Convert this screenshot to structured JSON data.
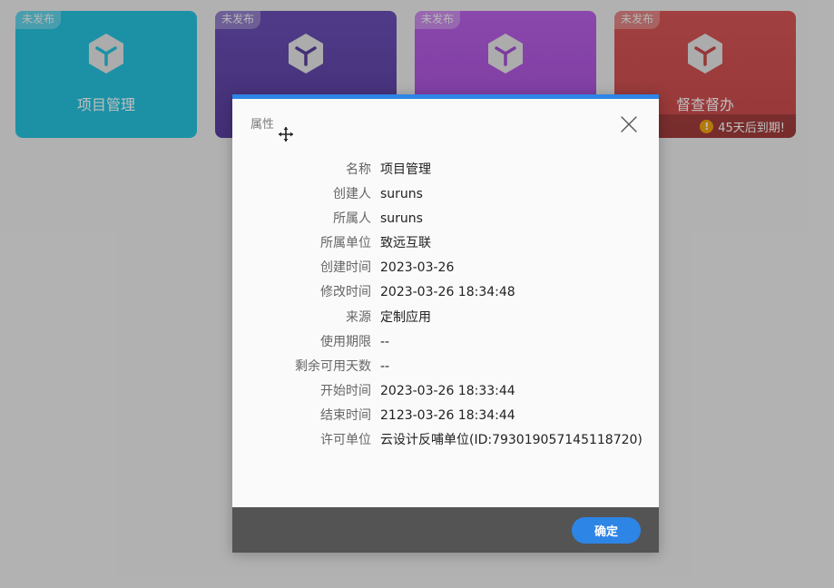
{
  "cards": [
    {
      "badge": "未发布",
      "title": "项目管理",
      "color": "#26c2de",
      "icon_color": "#26c2de"
    },
    {
      "badge": "未发布",
      "title": "",
      "color": "#6a4fb6",
      "icon_color": "#5a3f9e"
    },
    {
      "badge": "未发布",
      "title": "",
      "color": "#b860e6",
      "icon_color": "#a64fd6"
    },
    {
      "badge": "未发布",
      "title": "督查督办",
      "color": "#d75656",
      "icon_color": "#c94a4a",
      "expire_text": "45天后到期!",
      "expire_icon": "warning-icon"
    }
  ],
  "dialog": {
    "title": "属性",
    "confirm_label": "确定",
    "accent": "#2d85e6",
    "properties": [
      {
        "label": "名称",
        "value": "项目管理"
      },
      {
        "label": "创建人",
        "value": "suruns"
      },
      {
        "label": "所属人",
        "value": "suruns"
      },
      {
        "label": "所属单位",
        "value": "致远互联"
      },
      {
        "label": "创建时间",
        "value": "2023-03-26"
      },
      {
        "label": "修改时间",
        "value": "2023-03-26 18:34:48"
      },
      {
        "label": "来源",
        "value": "定制应用"
      },
      {
        "label": "使用期限",
        "value": "--"
      },
      {
        "label": "剩余可用天数",
        "value": "--"
      },
      {
        "label": "开始时间",
        "value": "2023-03-26 18:33:44"
      },
      {
        "label": "结束时间",
        "value": "2123-03-26 18:34:44"
      },
      {
        "label": "许可单位",
        "value": "云设计反哺单位(ID:793019057145118720)"
      }
    ]
  }
}
